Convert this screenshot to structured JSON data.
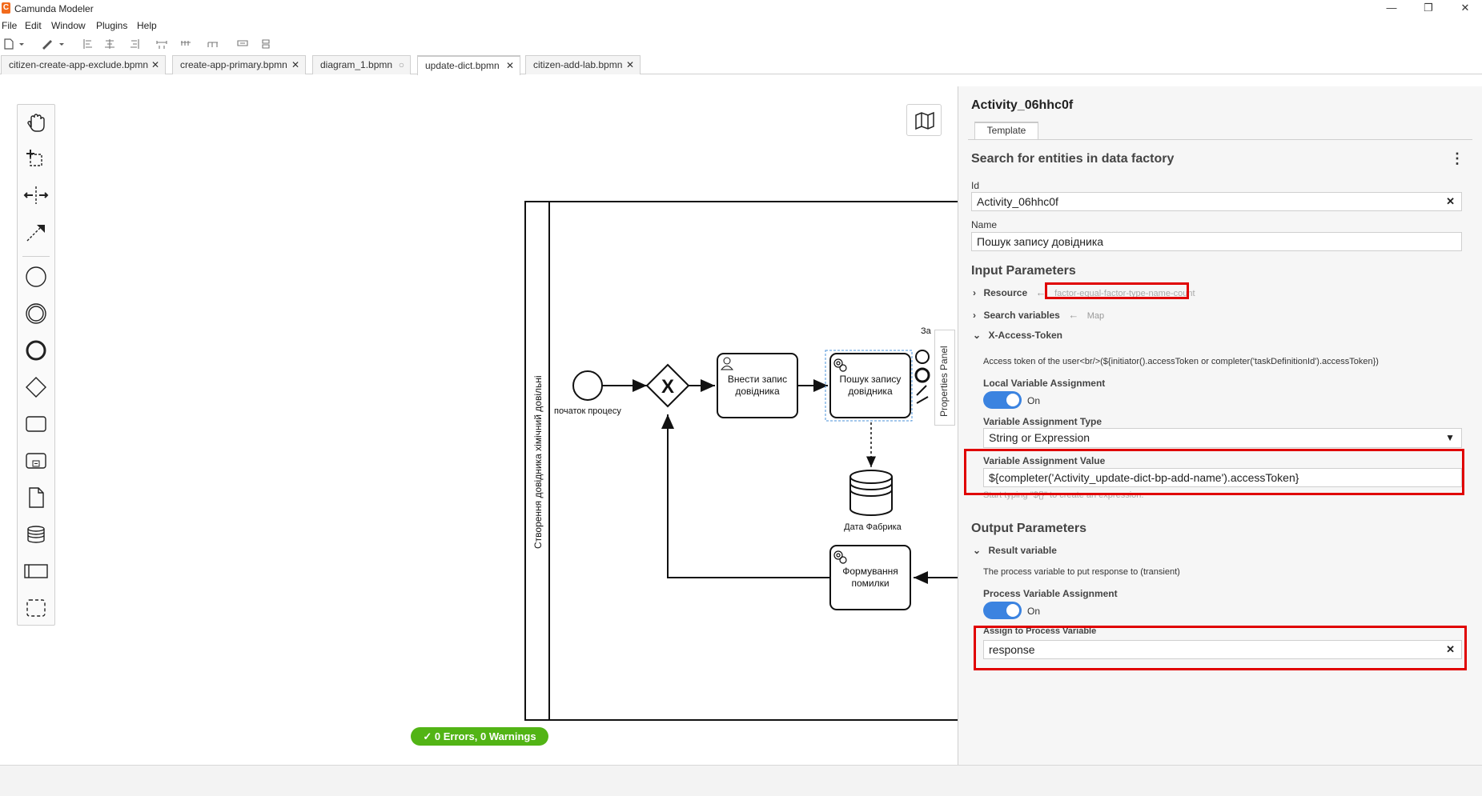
{
  "window": {
    "title": "Camunda Modeler",
    "app_icon": "C",
    "controls": {
      "minimize": "—",
      "maximize": "❐",
      "close": "✕"
    }
  },
  "menu": [
    "File",
    "Edit",
    "Window",
    "Plugins",
    "Help"
  ],
  "tabs": [
    {
      "label": "citizen-create-app-exclude.bpmn",
      "close": "✕"
    },
    {
      "label": "create-app-primary.bpmn",
      "close": "✕"
    },
    {
      "label": "diagram_1.bpmn",
      "close": "○"
    },
    {
      "label": "update-dict.bpmn",
      "close": "✕",
      "active": true
    },
    {
      "label": "citizen-add-lab.bpmn",
      "close": "✕"
    }
  ],
  "diagram": {
    "pool_label": "Створення довідника хімічний довільні",
    "start_event_label": "початок процесу",
    "gateway_symbol": "X",
    "task_user": [
      "Внести запис",
      "довідника"
    ],
    "task_search": [
      "Пошук запису",
      "довідника"
    ],
    "datastore_label": "Дата Фабрика",
    "task_error": [
      "Формування",
      "помилки"
    ],
    "cut_label": "За"
  },
  "canvas": {
    "properties_toggle": "Properties Panel",
    "status": "✓  0 Errors, 0 Warnings"
  },
  "panel": {
    "title": "Activity_06hhc0f",
    "tab": "Template",
    "template_name": "Search for entities in data factory",
    "menu_icon": "⋮",
    "id_label": "Id",
    "id_value": "Activity_06hhc0f",
    "name_label": "Name",
    "name_value": "Пошук запису довідника",
    "input_heading": "Input Parameters",
    "resource_label": "Resource",
    "resource_value": "factor-equal-factor-type-name-count",
    "search_vars_label": "Search variables",
    "search_vars_value": "Map",
    "xaccess_label": "X-Access-Token",
    "xaccess_desc": "Access token of the user<br/>(${initiator().accessToken or completer('taskDefinitionId').accessToken})",
    "local_assign_label": "Local Variable Assignment",
    "local_assign_state": "On",
    "assign_type_label": "Variable Assignment Type",
    "assign_type_value": "String or Expression",
    "assign_value_label": "Variable Assignment Value",
    "assign_value": "${completer('Activity_update-dict-bp-add-name').accessToken}",
    "assign_hint": "Start typing \"${}\" to create an expression.",
    "output_heading": "Output Parameters",
    "result_label": "Result variable",
    "result_desc": "The process variable to put response to (transient)",
    "process_assign_label": "Process Variable Assignment",
    "process_assign_state": "On",
    "assign_to_label": "Assign to Process Variable",
    "assign_to_value": "response",
    "clear_icon": "✕",
    "chevron_right": "›",
    "chevron_down": "⌄",
    "arrow_left": "←"
  },
  "colors": {
    "accent": "#3b83e0",
    "highlight": "#e00000",
    "status_ok": "#52b415"
  }
}
